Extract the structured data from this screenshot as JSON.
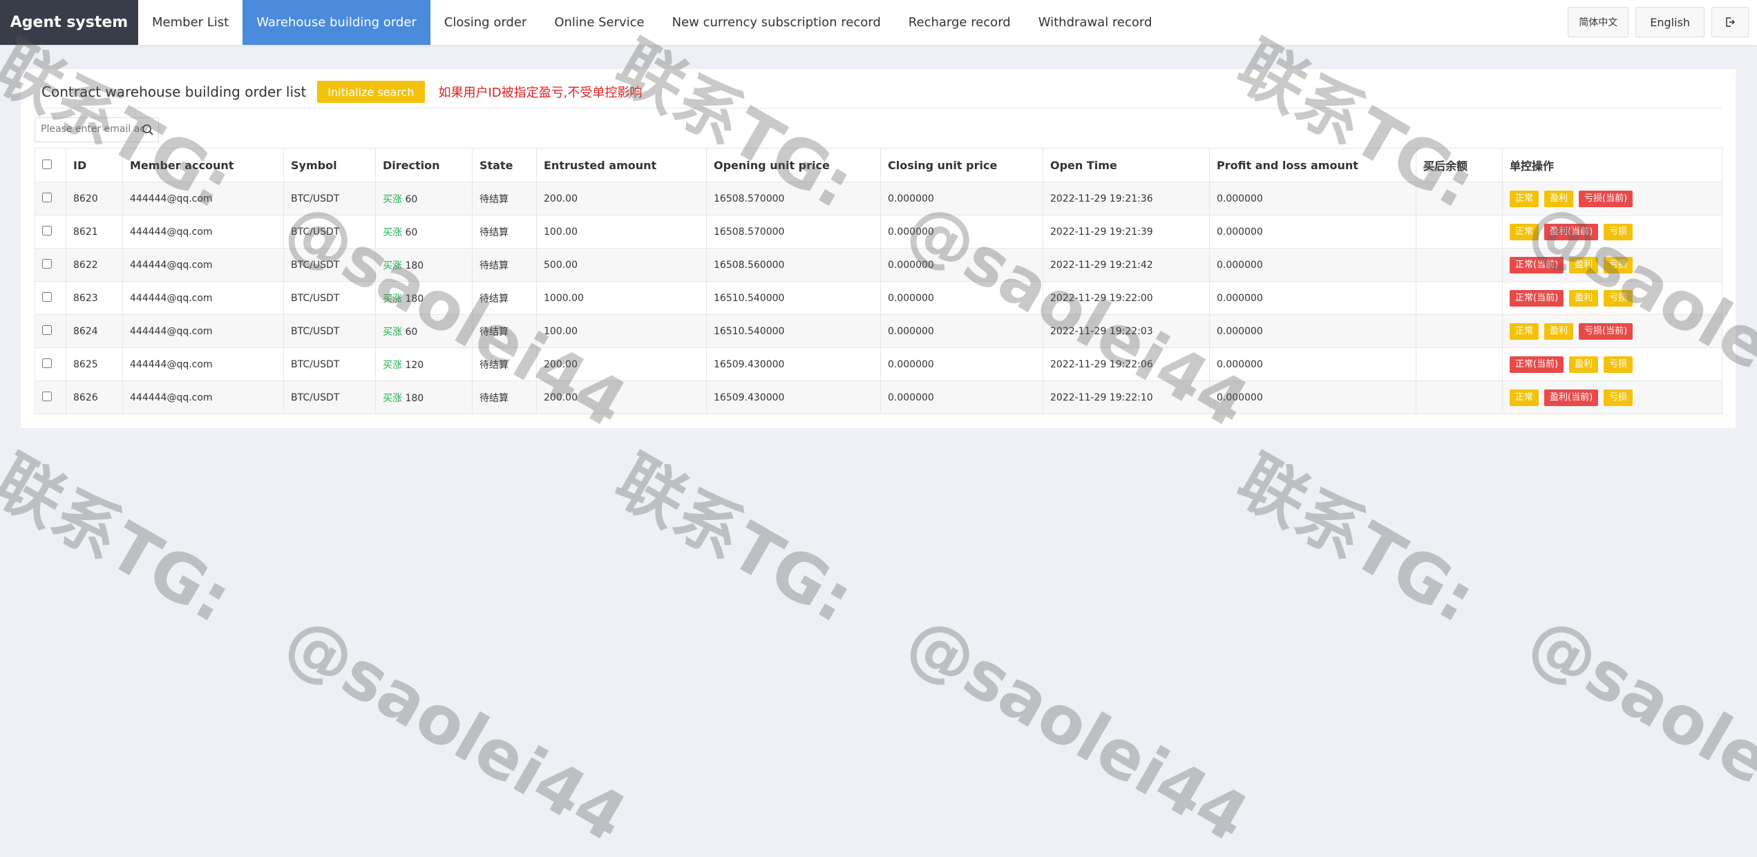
{
  "brand": "Agent system",
  "nav": [
    {
      "label": "Member List",
      "active": false
    },
    {
      "label": "Warehouse building order",
      "active": true
    },
    {
      "label": "Closing order",
      "active": false
    },
    {
      "label": "Online Service",
      "active": false
    },
    {
      "label": "New currency subscription record",
      "active": false
    },
    {
      "label": "Recharge record",
      "active": false
    },
    {
      "label": "Withdrawal record",
      "active": false
    }
  ],
  "top_right": {
    "lang_cn": "简体中文",
    "lang_en": "English",
    "logout_icon": "exit-icon"
  },
  "panel": {
    "title": "Contract warehouse building order list",
    "init_button": "Initialize search",
    "notice": "如果用户ID被指定盈亏,不受单控影响"
  },
  "search": {
    "placeholder": "Please enter email acco"
  },
  "table": {
    "headers": [
      "ID",
      "Member account",
      "Symbol",
      "Direction",
      "State",
      "Entrusted amount",
      "Opening unit price",
      "Closing unit price",
      "Open Time",
      "Profit and loss amount",
      "买后余额",
      "单控操作"
    ],
    "rows": [
      {
        "id": "8620",
        "account": "444444@qq.com",
        "symbol": "BTC/USDT",
        "dir_label": "买涨",
        "dir_value": "60",
        "state": "待结算",
        "amount": "200.00",
        "open_price": "16508.570000",
        "close_price": "0.000000",
        "open_time": "2022-11-29 19:21:36",
        "pnl": "0.000000",
        "balance": "",
        "ops": [
          {
            "label": "正常",
            "color": "yellow"
          },
          {
            "label": "盈利",
            "color": "yellow"
          },
          {
            "label": "亏损(当前)",
            "color": "red"
          }
        ]
      },
      {
        "id": "8621",
        "account": "444444@qq.com",
        "symbol": "BTC/USDT",
        "dir_label": "买涨",
        "dir_value": "60",
        "state": "待结算",
        "amount": "100.00",
        "open_price": "16508.570000",
        "close_price": "0.000000",
        "open_time": "2022-11-29 19:21:39",
        "pnl": "0.000000",
        "balance": "",
        "ops": [
          {
            "label": "正常",
            "color": "yellow"
          },
          {
            "label": "盈利(当前)",
            "color": "red"
          },
          {
            "label": "亏损",
            "color": "yellow"
          }
        ]
      },
      {
        "id": "8622",
        "account": "444444@qq.com",
        "symbol": "BTC/USDT",
        "dir_label": "买涨",
        "dir_value": "180",
        "state": "待结算",
        "amount": "500.00",
        "open_price": "16508.560000",
        "close_price": "0.000000",
        "open_time": "2022-11-29 19:21:42",
        "pnl": "0.000000",
        "balance": "",
        "ops": [
          {
            "label": "正常(当前)",
            "color": "red"
          },
          {
            "label": "盈利",
            "color": "yellow"
          },
          {
            "label": "亏损",
            "color": "yellow"
          }
        ]
      },
      {
        "id": "8623",
        "account": "444444@qq.com",
        "symbol": "BTC/USDT",
        "dir_label": "买涨",
        "dir_value": "180",
        "state": "待结算",
        "amount": "1000.00",
        "open_price": "16510.540000",
        "close_price": "0.000000",
        "open_time": "2022-11-29 19:22:00",
        "pnl": "0.000000",
        "balance": "",
        "ops": [
          {
            "label": "正常(当前)",
            "color": "red"
          },
          {
            "label": "盈利",
            "color": "yellow"
          },
          {
            "label": "亏损",
            "color": "yellow"
          }
        ]
      },
      {
        "id": "8624",
        "account": "444444@qq.com",
        "symbol": "BTC/USDT",
        "dir_label": "买涨",
        "dir_value": "60",
        "state": "待结算",
        "amount": "100.00",
        "open_price": "16510.540000",
        "close_price": "0.000000",
        "open_time": "2022-11-29 19:22:03",
        "pnl": "0.000000",
        "balance": "",
        "ops": [
          {
            "label": "正常",
            "color": "yellow"
          },
          {
            "label": "盈利",
            "color": "yellow"
          },
          {
            "label": "亏损(当前)",
            "color": "red"
          }
        ]
      },
      {
        "id": "8625",
        "account": "444444@qq.com",
        "symbol": "BTC/USDT",
        "dir_label": "买涨",
        "dir_value": "120",
        "state": "待结算",
        "amount": "200.00",
        "open_price": "16509.430000",
        "close_price": "0.000000",
        "open_time": "2022-11-29 19:22:06",
        "pnl": "0.000000",
        "balance": "",
        "ops": [
          {
            "label": "正常(当前)",
            "color": "red"
          },
          {
            "label": "盈利",
            "color": "yellow"
          },
          {
            "label": "亏损",
            "color": "yellow"
          }
        ]
      },
      {
        "id": "8626",
        "account": "444444@qq.com",
        "symbol": "BTC/USDT",
        "dir_label": "买涨",
        "dir_value": "180",
        "state": "待结算",
        "amount": "200.00",
        "open_price": "16509.430000",
        "close_price": "0.000000",
        "open_time": "2022-11-29 19:22:10",
        "pnl": "0.000000",
        "balance": "",
        "ops": [
          {
            "label": "正常",
            "color": "yellow"
          },
          {
            "label": "盈利(当前)",
            "color": "red"
          },
          {
            "label": "亏损",
            "color": "yellow"
          }
        ]
      }
    ]
  },
  "watermark": {
    "line1": "联系TG:",
    "line2": "@saolei44"
  },
  "colors": {
    "nav_active": "#4a8bdc",
    "brand_bg": "#393d49",
    "button_yellow": "#f4c20d",
    "button_red": "#e84a4a",
    "buy_green": "#22b14c",
    "notice_red": "#e02020"
  }
}
